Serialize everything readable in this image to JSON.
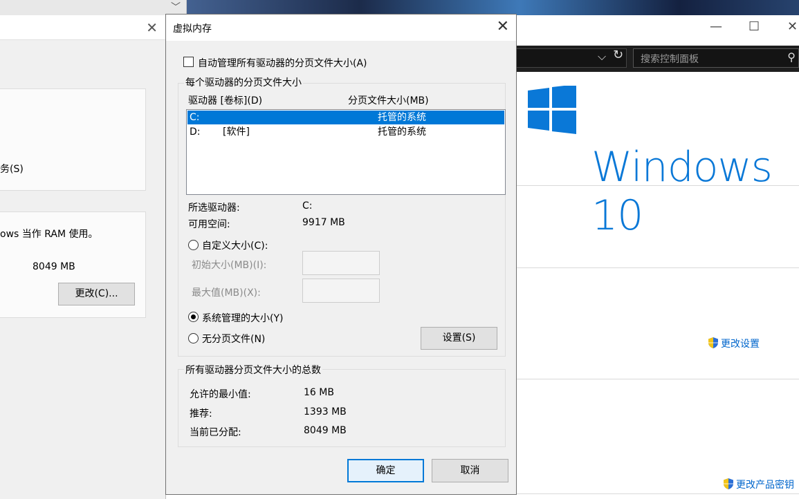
{
  "left_window": {
    "service_text": "务(S)",
    "ram_text": "ows 当作 RAM 使用。",
    "size_text": "8049 MB",
    "change_button": "更改(C)...",
    "close_glyph": "✕",
    "tab_chevron": "﹀"
  },
  "right_window": {
    "min_glyph": "—",
    "max_glyph": "☐",
    "close_glyph": "✕",
    "address_chevron": "⌵",
    "refresh_glyph": "↻",
    "search_placeholder": "搜索控制面板",
    "search_glyph": "⚲",
    "wordmark": "Windows 10",
    "change_settings_link": "更改设置",
    "change_product_key_link": "更改产品密钥",
    "logo_color": "#0a78d7"
  },
  "dialog": {
    "title": "虚拟内存",
    "close_glyph": "✕",
    "auto_manage_label": "自动管理所有驱动器的分页文件大小(A)",
    "auto_manage_checked": false,
    "per_drive_group": "每个驱动器的分页文件大小",
    "columns": {
      "drive": "驱动器 [卷标](D)",
      "size": "分页文件大小(MB)"
    },
    "drives": [
      {
        "letter": "C:",
        "volume": "",
        "size": "托管的系统",
        "selected": true
      },
      {
        "letter": "D:",
        "volume": "[软件]",
        "size": "托管的系统",
        "selected": false
      }
    ],
    "selected_drive_label": "所选驱动器:",
    "selected_drive_value": "C:",
    "available_space_label": "可用空间:",
    "available_space_value": "9917 MB",
    "custom_size_label": "自定义大小(C):",
    "initial_size_label": "初始大小(MB)(I):",
    "max_size_label": "最大值(MB)(X):",
    "system_managed_label": "系统管理的大小(Y)",
    "no_paging_label": "无分页文件(N)",
    "selected_option": "system_managed",
    "set_button": "设置(S)",
    "totals_group": "所有驱动器分页文件大小的总数",
    "min_allowed_label": "允许的最小值:",
    "min_allowed_value": "16 MB",
    "recommended_label": "推荐:",
    "recommended_value": "1393 MB",
    "allocated_label": "当前已分配:",
    "allocated_value": "8049 MB",
    "ok_button": "确定",
    "cancel_button": "取消",
    "accent_color": "#0078d7"
  }
}
